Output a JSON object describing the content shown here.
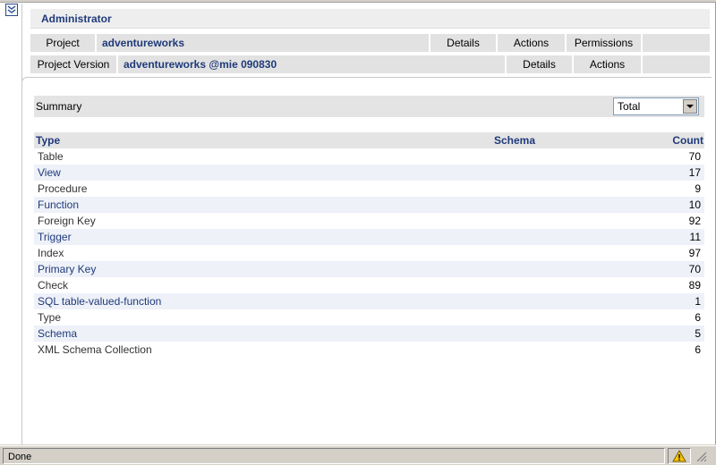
{
  "header": {
    "title": "Administrator"
  },
  "project_bar": {
    "label": "Project",
    "value": "adventureworks",
    "details_label": "Details",
    "actions_label": "Actions",
    "permissions_label": "Permissions"
  },
  "version_bar": {
    "label": "Project Version",
    "value": "adventureworks @mie 090830",
    "details_label": "Details",
    "actions_label": "Actions"
  },
  "summary": {
    "label": "Summary",
    "select_value": "Total"
  },
  "table": {
    "columns": [
      "Type",
      "Schema",
      "Count"
    ],
    "rows": [
      {
        "type": "Table",
        "count": "70"
      },
      {
        "type": "View",
        "count": "17"
      },
      {
        "type": "Procedure",
        "count": "9"
      },
      {
        "type": "Function",
        "count": "10"
      },
      {
        "type": "Foreign Key",
        "count": "92"
      },
      {
        "type": "Trigger",
        "count": "11"
      },
      {
        "type": "Index",
        "count": "97"
      },
      {
        "type": "Primary Key",
        "count": "70"
      },
      {
        "type": "Check",
        "count": "89"
      },
      {
        "type": "SQL table-valued-function",
        "count": "1"
      },
      {
        "type": "Type",
        "count": "6"
      },
      {
        "type": "Schema",
        "count": "5"
      },
      {
        "type": "XML Schema Collection",
        "count": "6"
      }
    ]
  },
  "status": {
    "text": "Done"
  },
  "icons": {
    "collapse": "double-chevron-down-icon",
    "dropdown": "triangle-down-icon",
    "warning": "warning-icon",
    "resize": "resize-grip-icon"
  },
  "colors": {
    "accent": "#1f3a7a",
    "bar_bg": "#e2e2e2",
    "row_alt": "#eef1f8"
  }
}
